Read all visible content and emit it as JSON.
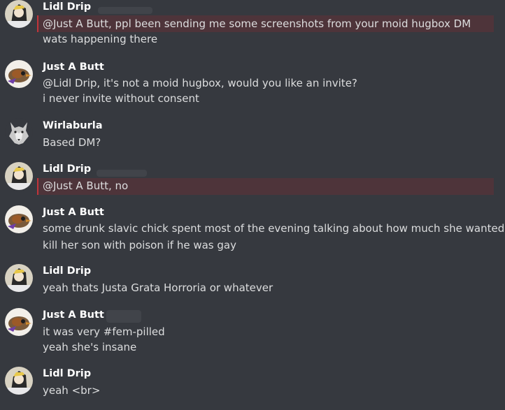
{
  "messages": [
    {
      "author": "Lidl Drip",
      "lines": [
        "@Just A Butt, ppl been sending me some screenshots from your moid hugbox DM",
        "wats happening there"
      ]
    },
    {
      "author": "Just A Butt",
      "lines": [
        "@Lidl Drip, it's not a moid hugbox, would you like an invite?",
        "i never invite without consent"
      ]
    },
    {
      "author": "Wirlaburla",
      "lines": [
        "Based DM?"
      ]
    },
    {
      "author": "Lidl Drip",
      "lines": [
        "@Just A Butt, no"
      ]
    },
    {
      "author": "Just A Butt",
      "lines": [
        "some drunk slavic chick spent most of the evening talking about how much she wanted to",
        "kill her son with poison if he was gay"
      ]
    },
    {
      "author": "Lidl Drip",
      "lines": [
        "yeah thats Justa Grata Horroria or whatever"
      ]
    },
    {
      "author": "Just A Butt",
      "lines": [
        "it was very #fem-pilled",
        "yeah she's insane"
      ]
    },
    {
      "author": "Lidl Drip",
      "lines": [
        "yeah <br>"
      ]
    }
  ],
  "colors": {
    "background": "#36393f",
    "mention_highlight": "#c0353b",
    "author": "#ffffff",
    "text": "#dcddde"
  },
  "avatars": {
    "lidl_drip": "anime-avatar",
    "just_a_butt": "bird-avatar",
    "wirlaburla": "wolf-avatar"
  }
}
